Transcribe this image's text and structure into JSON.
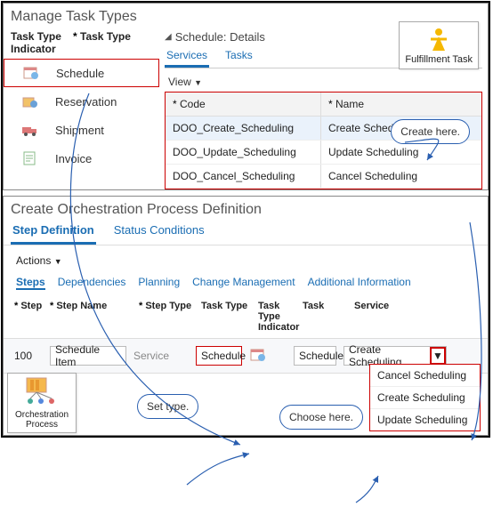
{
  "top": {
    "title": "Manage Task Types",
    "columns": {
      "indicator": "Task Type Indicator",
      "type": "Task Type"
    },
    "tasks": [
      {
        "label": "Schedule"
      },
      {
        "label": "Reservation"
      },
      {
        "label": "Shipment"
      },
      {
        "label": "Invoice"
      }
    ],
    "detail_title": "Schedule: Details",
    "subtabs": {
      "services": "Services",
      "tasks": "Tasks"
    },
    "view_label": "View",
    "grid": {
      "headers": {
        "code": "Code",
        "name": "Name"
      },
      "rows": [
        {
          "code": "DOO_Create_Scheduling",
          "name": "Create Scheduling"
        },
        {
          "code": "DOO_Update_Scheduling",
          "name": "Update Scheduling"
        },
        {
          "code": "DOO_Cancel_Scheduling",
          "name": "Cancel Scheduling"
        }
      ]
    },
    "fulfillment_label": "Fulfillment Task",
    "callout_create": "Create here."
  },
  "bottom": {
    "title": "Create Orchestration Process Definition",
    "tabs": {
      "step_def": "Step Definition",
      "status": "Status Conditions"
    },
    "actions_label": "Actions",
    "step_tabs": {
      "steps": "Steps",
      "deps": "Dependencies",
      "planning": "Planning",
      "change": "Change Management",
      "addl": "Additional Information"
    },
    "cols": {
      "step": "Step",
      "step_name": "Step Name",
      "step_type": "Step Type",
      "task_type": "Task Type",
      "task_ind": "Task Type Indicator",
      "task": "Task",
      "service": "Service"
    },
    "row": {
      "step": "100",
      "step_name": "Schedule Item",
      "step_type": "Service",
      "task_type": "Schedule",
      "task": "Schedule",
      "service": "Create Scheduling"
    },
    "dropdown": [
      "Cancel Scheduling",
      "Create Scheduling",
      "Update Scheduling"
    ],
    "orch_label": "Orchestration Process",
    "callout_set": "Set type.",
    "callout_choose": "Choose here."
  }
}
